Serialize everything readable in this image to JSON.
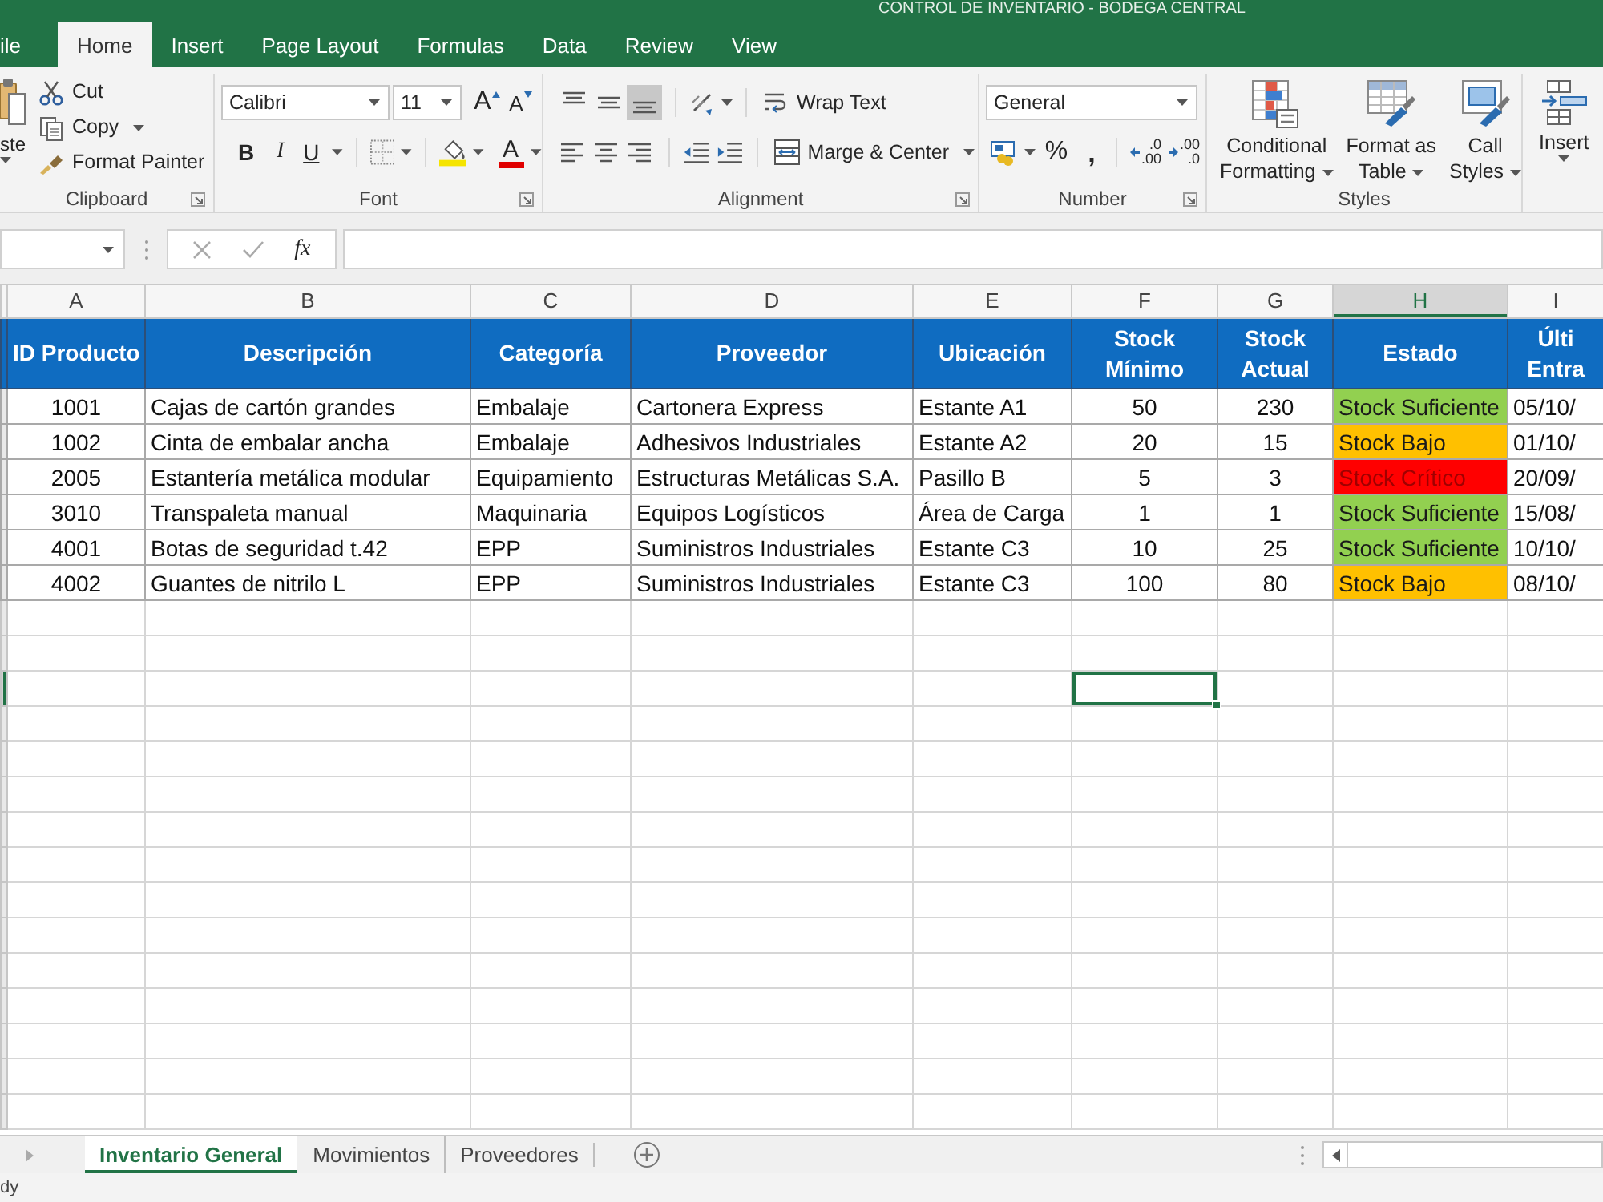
{
  "window": {
    "title": "CONTROL DE INVENTARIO - BODEGA CENTRAL"
  },
  "ribbon_tabs": [
    {
      "label": "ile",
      "selected": false
    },
    {
      "label": "Home",
      "selected": true
    },
    {
      "label": "Insert",
      "selected": false
    },
    {
      "label": "Page Layout",
      "selected": false
    },
    {
      "label": "Formulas",
      "selected": false
    },
    {
      "label": "Data",
      "selected": false
    },
    {
      "label": "Review",
      "selected": false
    },
    {
      "label": "View",
      "selected": false
    }
  ],
  "ribbon": {
    "clipboard": {
      "label": "Clipboard",
      "paste": "ste",
      "cut": "Cut",
      "copy": "Copy",
      "format_painter": "Format Painter"
    },
    "font": {
      "label": "Font",
      "font_name": "Calibri",
      "font_size": "11",
      "grow": "A",
      "shrink": "A",
      "bold": "B",
      "italic": "I",
      "underline": "U",
      "font_color": "A"
    },
    "alignment": {
      "label": "Alignment",
      "vertical_align": [
        {
          "selected": false
        },
        {
          "selected": false
        },
        {
          "selected": true
        }
      ],
      "horizontal_align": [
        {
          "selected": false
        },
        {
          "selected": false
        },
        {
          "selected": false
        }
      ],
      "wrap_text": "Wrap Text",
      "merge_center": "Marge & Center"
    },
    "number": {
      "label": "Number",
      "format": "General",
      "percent": "%",
      "comma": ",",
      "increase_decimal": [
        ".0",
        ".00"
      ],
      "decrease_decimal": [
        ".00",
        ".0"
      ]
    },
    "styles": {
      "label": "Styles",
      "buttons": [
        {
          "kind": "conditional",
          "lines": [
            "Conditional",
            "Formatting"
          ]
        },
        {
          "kind": "table",
          "lines": [
            "Format as",
            "Table"
          ]
        },
        {
          "kind": "cell",
          "lines": [
            "Call",
            "Styles"
          ]
        }
      ]
    },
    "cells": {
      "insert": "Insert"
    }
  },
  "formula_bar": {
    "function_label": "fx"
  },
  "sheet": {
    "columns": [
      {
        "letter": "A",
        "selected": false,
        "active_cell": false
      },
      {
        "letter": "B",
        "selected": false,
        "active_cell": false
      },
      {
        "letter": "C",
        "selected": false,
        "active_cell": false
      },
      {
        "letter": "D",
        "selected": false,
        "active_cell": false
      },
      {
        "letter": "E",
        "selected": false,
        "active_cell": false
      },
      {
        "letter": "F",
        "selected": false,
        "active_cell": true
      },
      {
        "letter": "G",
        "selected": false,
        "active_cell": false
      },
      {
        "letter": "H",
        "selected": true,
        "active_cell": false
      },
      {
        "letter": "I",
        "selected": false,
        "active_cell": false
      }
    ],
    "header": [
      {
        "lines": [
          "ID Producto"
        ]
      },
      {
        "lines": [
          "Descripción"
        ]
      },
      {
        "lines": [
          "Categoría"
        ]
      },
      {
        "lines": [
          "Proveedor"
        ]
      },
      {
        "lines": [
          "Ubicación"
        ]
      },
      {
        "lines": [
          "Stock",
          "Mínimo"
        ]
      },
      {
        "lines": [
          "Stock",
          "Actual"
        ]
      },
      {
        "lines": [
          "Estado"
        ]
      },
      {
        "lines": [
          "Últi",
          "Entra"
        ]
      }
    ],
    "rows": [
      {
        "id": "1001",
        "description": "Cajas de cartón grandes",
        "category": "Embalaje",
        "supplier": "Cartonera Express",
        "location": "Estante A1",
        "stock_min": "50",
        "stock_current": "230",
        "status": {
          "text": "Stock Suficiente",
          "color": "#92d050",
          "kind": "ok"
        },
        "column_i": "05/10/"
      },
      {
        "id": "1002",
        "description": "Cinta de embalar ancha",
        "category": "Embalaje",
        "supplier": "Adhesivos Industriales",
        "location": "Estante A2",
        "stock_min": "20",
        "stock_current": "15",
        "status": {
          "text": "Stock Bajo",
          "color": "#ffc000",
          "kind": "low"
        },
        "column_i": "01/10/"
      },
      {
        "id": "2005",
        "description": "Estantería metálica modular",
        "category": "Equipamiento",
        "supplier": "Estructuras Metálicas S.A.",
        "location": "Pasillo B",
        "stock_min": "5",
        "stock_current": "3",
        "status": {
          "text": "Stock Crítico",
          "color": "#ff0000",
          "kind": "critical"
        },
        "column_i": "20/09/"
      },
      {
        "id": "3010",
        "description": "Transpaleta manual",
        "category": "Maquinaria",
        "supplier": "Equipos Logísticos",
        "location": "Área de Carga",
        "stock_min": "1",
        "stock_current": "1",
        "status": {
          "text": "Stock Suficiente",
          "color": "#92d050",
          "kind": "ok"
        },
        "column_i": "15/08/"
      },
      {
        "id": "4001",
        "description": "Botas de seguridad t.42",
        "category": "EPP",
        "supplier": "Suministros Industriales",
        "location": "Estante C3",
        "stock_min": "10",
        "stock_current": "25",
        "status": {
          "text": "Stock Suficiente",
          "color": "#92d050",
          "kind": "ok"
        },
        "column_i": "10/10/"
      },
      {
        "id": "4002",
        "description": "Guantes de nitrilo L",
        "category": "EPP",
        "supplier": "Suministros Industriales",
        "location": "Estante C3",
        "stock_min": "100",
        "stock_current": "80",
        "status": {
          "text": "Stock Bajo",
          "color": "#ffc000",
          "kind": "low"
        },
        "column_i": "08/10/"
      }
    ],
    "blank_rows": [
      {
        "selected": false
      },
      {
        "selected": false
      },
      {
        "selected": true
      },
      {
        "selected": false
      },
      {
        "selected": false
      },
      {
        "selected": false
      },
      {
        "selected": false
      },
      {
        "selected": false
      },
      {
        "selected": false
      },
      {
        "selected": false
      },
      {
        "selected": false
      },
      {
        "selected": false
      },
      {
        "selected": false
      },
      {
        "selected": false
      },
      {
        "selected": false
      }
    ]
  },
  "sheet_tabs": [
    {
      "label": "Inventario General",
      "selected": true
    },
    {
      "label": "Movimientos",
      "selected": false
    },
    {
      "label": "Proveedores",
      "selected": false
    }
  ],
  "status_bar": {
    "text": "dy"
  }
}
